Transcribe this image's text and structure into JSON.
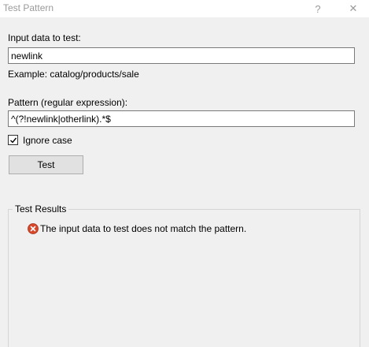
{
  "window": {
    "title": "Test Pattern",
    "help_glyph": "?",
    "close_glyph": "✕"
  },
  "input": {
    "label": "Input data to test:",
    "value": "newlink",
    "example": "Example: catalog/products/sale"
  },
  "pattern": {
    "label": "Pattern (regular expression):",
    "value": "^(?!newlink|otherlink).*$"
  },
  "ignore_case": {
    "label": "Ignore case",
    "checked": true
  },
  "test_button": {
    "label": "Test"
  },
  "results": {
    "group_title": "Test Results",
    "icon": "error-icon",
    "message": "The input data to test does not match the pattern."
  },
  "colors": {
    "error_red": "#d9472b",
    "background": "#f0f0f0",
    "title_text": "#9a9a9a"
  }
}
